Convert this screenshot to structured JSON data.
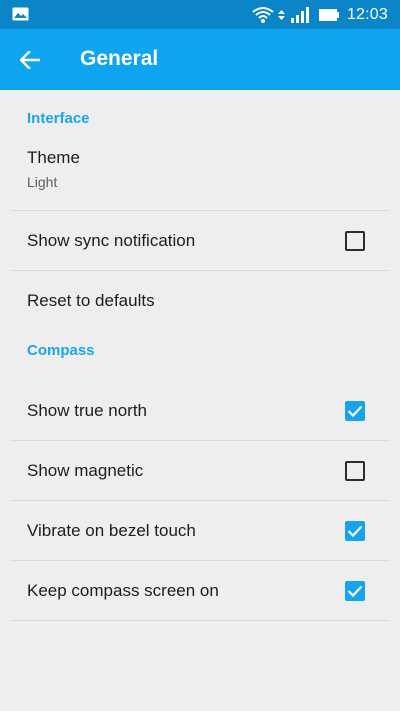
{
  "status_bar": {
    "time": "12:03",
    "icons": [
      "gallery-icon",
      "wifi-icon",
      "signal-icon",
      "battery-icon"
    ]
  },
  "app_bar": {
    "title": "General",
    "back_icon": "arrow-left-icon",
    "color": "#0ea4ef"
  },
  "sections": {
    "interface": {
      "header": "Interface",
      "theme": {
        "label": "Theme",
        "value": "Light"
      },
      "sync": {
        "label": "Show sync notification",
        "checked": false
      },
      "reset": {
        "label": "Reset to defaults"
      }
    },
    "compass": {
      "header": "Compass",
      "true_north": {
        "label": "Show true north",
        "checked": true
      },
      "magnetic": {
        "label": "Show magnetic",
        "checked": false
      },
      "vibrate": {
        "label": "Vibrate on bezel touch",
        "checked": true
      },
      "keep_on": {
        "label": "Keep compass screen on",
        "checked": true
      }
    }
  },
  "colors": {
    "accent": "#1aa6e8",
    "status_bar": "#0b85c8",
    "background": "#eeeeee"
  }
}
